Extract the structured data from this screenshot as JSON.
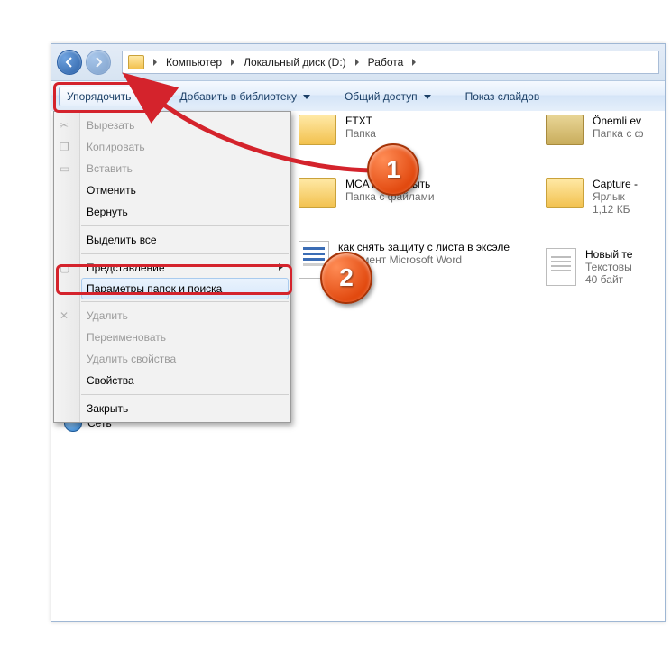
{
  "breadcrumb": {
    "root": "Компьютер",
    "disk": "Локальный диск (D:)",
    "folder": "Работа"
  },
  "toolbar": {
    "organize": "Упорядочить",
    "library": "Добавить в библиотеку",
    "share": "Общий доступ",
    "slideshow": "Показ слайдов"
  },
  "menu": {
    "cut": "Вырезать",
    "copy": "Копировать",
    "paste": "Вставить",
    "undo": "Отменить",
    "redo": "Вернуть",
    "select_all": "Выделить все",
    "view": "Представление",
    "folder_options": "Параметры папок и поиска",
    "delete": "Удалить",
    "rename": "Переименовать",
    "remove_props": "Удалить свойства",
    "properties": "Свойства",
    "close": "Закрыть"
  },
  "markers": {
    "one": "1",
    "two": "2"
  },
  "files": {
    "col_left": [
      {
        "name": "FTXT",
        "sub1": "Папка",
        "sub2": ""
      },
      {
        "name": "MCA как открыть",
        "sub1": "Папка с файлами",
        "sub2": ""
      },
      {
        "name": "как снять защиту с листа в эксэле",
        "sub1": "Документ Microsoft Word",
        "sub2": ""
      }
    ],
    "col_right": [
      {
        "name": "Önemli ev",
        "sub1": "Папка с ф",
        "sub2": ""
      },
      {
        "name": "Capture -",
        "sub1": "Ярлык",
        "sub2": "1,12 КБ"
      },
      {
        "name": "Новый те",
        "sub1": "Текстовы",
        "sub2": "40 байт"
      }
    ]
  },
  "sidebar": {
    "network": "Сеть"
  }
}
